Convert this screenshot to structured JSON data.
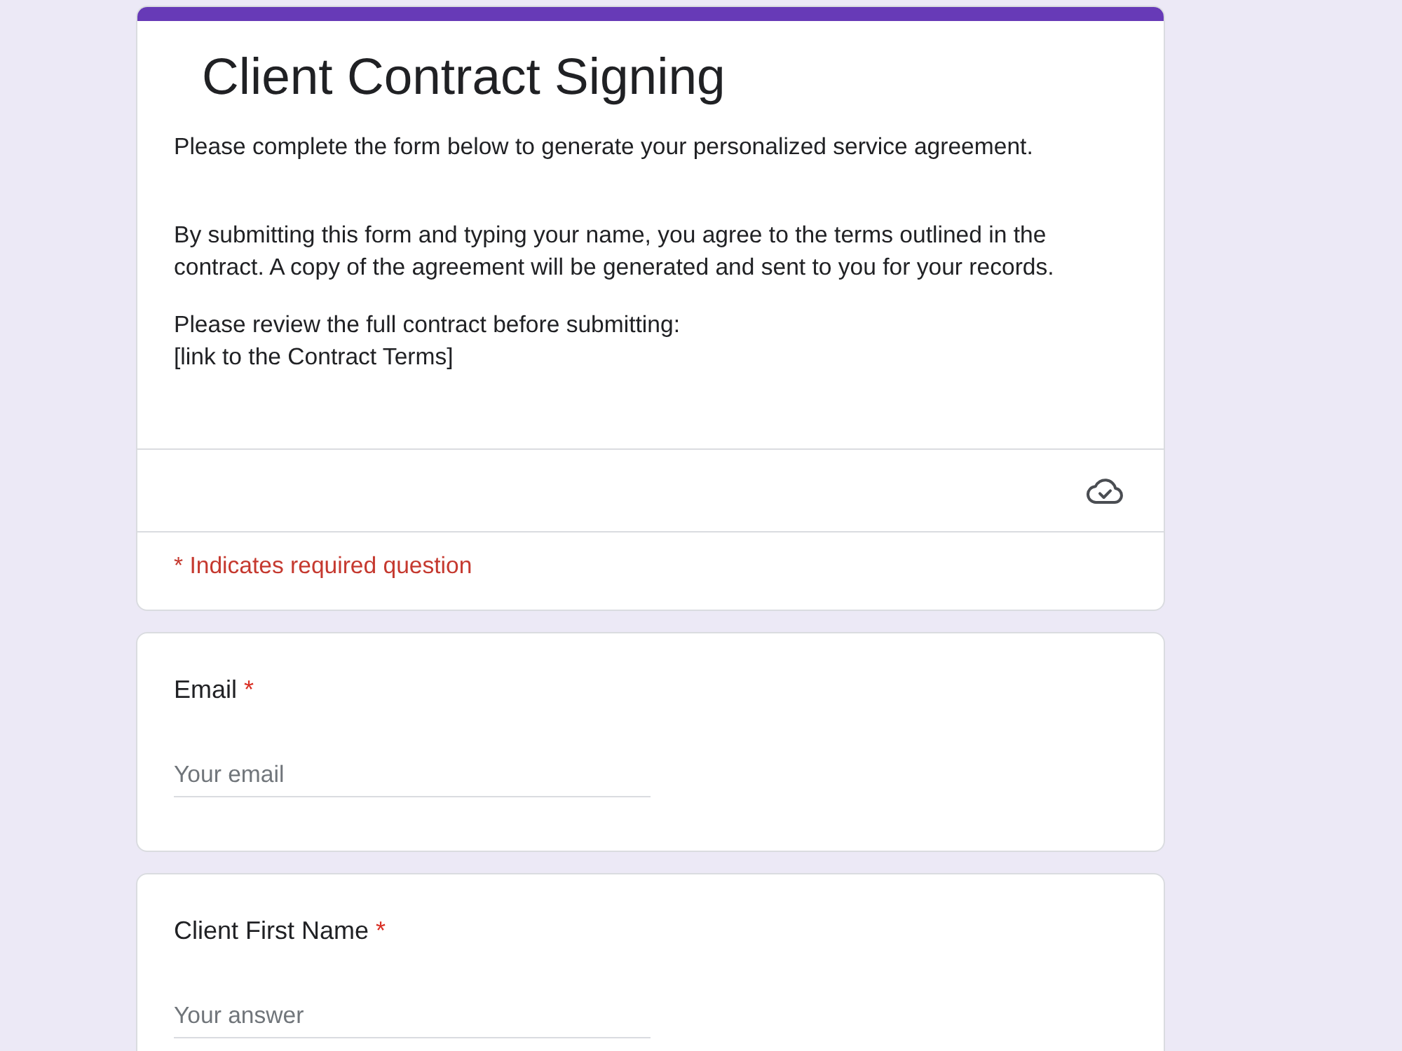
{
  "form": {
    "title": "Client Contract Signing",
    "description": [
      "Please complete the form below to generate your personalized service agreement.",
      "By submitting this form and typing your name, you agree to the terms outlined in the contract. A copy of the agreement will be generated and sent to you for your records.",
      "Please review the full contract before submitting:\n[link to the Contract Terms]"
    ],
    "required_note": "* Indicates required question"
  },
  "questions": [
    {
      "label": "Email",
      "required_mark": "*",
      "placeholder": "Your email"
    },
    {
      "label": "Client First Name",
      "required_mark": "*",
      "placeholder": "Your answer"
    }
  ]
}
